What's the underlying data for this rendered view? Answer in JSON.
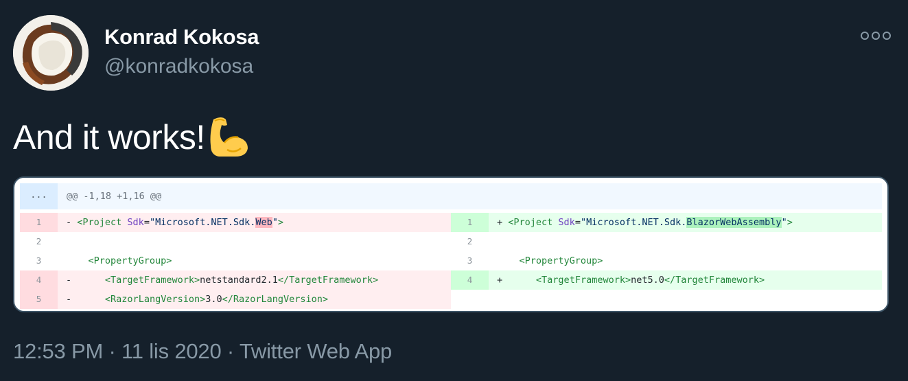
{
  "author": {
    "name": "Konrad Kokosa",
    "handle": "@konradkokosa"
  },
  "tweet": {
    "text": "And it works!",
    "emoji_icon": "flexed-biceps-icon"
  },
  "diff": {
    "hunk_expand": "...",
    "hunk_header": "@@ -1,18 +1,16 @@",
    "left": [
      {
        "num": "1",
        "prefix": "- ",
        "tag_open": "<Project ",
        "attr": "Sdk",
        "eq": "=",
        "str_a": "\"Microsoft.NET.Sdk.",
        "hl": "Web",
        "str_b": "\"",
        "tag_close": ">"
      },
      {
        "num": "2"
      },
      {
        "num": "3",
        "indent": "    ",
        "text": "<PropertyGroup>"
      },
      {
        "num": "4",
        "prefix": "-",
        "indent": "      ",
        "t1": "<TargetFramework>",
        "val": "netstandard2.1",
        "t2": "</TargetFramework>"
      },
      {
        "num": "5",
        "prefix": "-",
        "indent": "      ",
        "t1": "<RazorLangVersion>",
        "val": "3.0",
        "t2": "</RazorLangVersion>"
      }
    ],
    "right": [
      {
        "num": "1",
        "prefix": "+ ",
        "tag_open": "<Project ",
        "attr": "Sdk",
        "eq": "=",
        "str_a": "\"Microsoft.NET.Sdk.",
        "hl": "BlazorWebAssembly",
        "str_b": "\"",
        "tag_close": ">"
      },
      {
        "num": "2"
      },
      {
        "num": "3",
        "indent": "    ",
        "text": "<PropertyGroup>"
      },
      {
        "num": "4",
        "prefix": "+",
        "indent": "      ",
        "t1": "<TargetFramework>",
        "val": "net5.0",
        "t2": "</TargetFramework>"
      }
    ]
  },
  "meta": {
    "time": "12:53 PM",
    "sep1": " · ",
    "date": "11 lis 2020",
    "sep2": " · ",
    "source": "Twitter Web App"
  },
  "colors": {
    "background": "#15202b",
    "secondary_text": "#8899a6",
    "diff_deleted": "#ffeef0",
    "diff_added": "#e6ffed"
  }
}
